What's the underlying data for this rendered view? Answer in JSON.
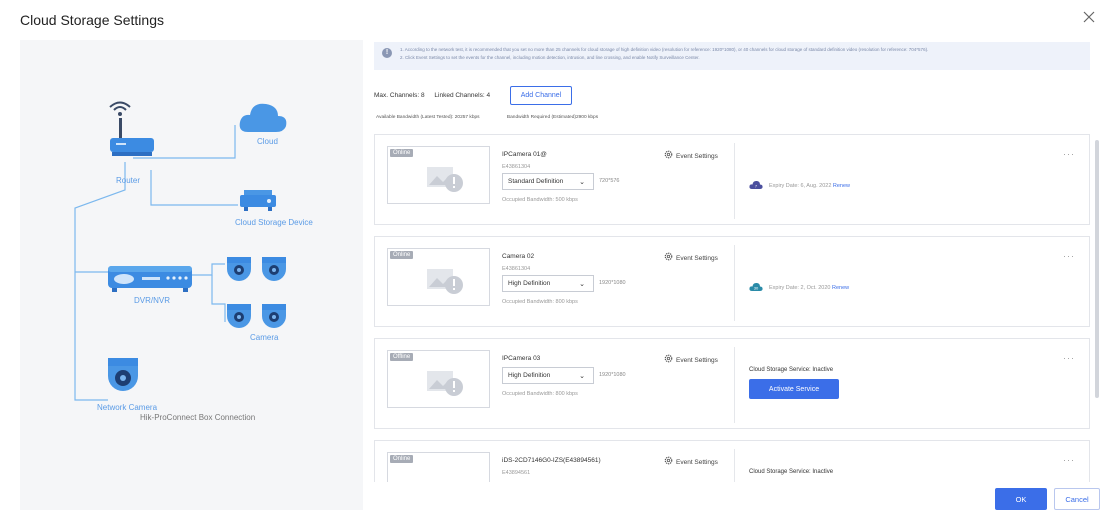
{
  "dialog": {
    "title": "Cloud Storage Settings",
    "close_icon": "close-icon"
  },
  "diagram": {
    "router": "Router",
    "cloud": "Cloud",
    "cloud_storage_device": "Cloud Storage Device",
    "dvr_nvr": "DVR/NVR",
    "camera": "Camera",
    "network_camera": "Network Camera",
    "hik_connection": "Hik-ProConnect Box Connection"
  },
  "notice": {
    "line1": "1. According to the network test, it is recommended that you set no more than 25 channels for cloud storage of high definition video (resolution for reference: 1920*1080), or 40 channels for cloud storage of standard definition video (resolution for reference: 704*576).",
    "line2": "2. Click Event Settings to set the events for the channel, including motion detection, intrusion, and line crossing, and enable Notify Surveillance Center."
  },
  "channels": {
    "max_label": "Max. Channels: 8",
    "linked_label": "Linked Channels: 4",
    "add_button": "Add Channel",
    "available_bw": "Available Bandwidth (Latest Tested): 20257 kbps",
    "required_bw": "Bandwidth Required (Estimated)2900 kbps"
  },
  "cards": [
    {
      "status": "Online",
      "name": "IPCamera 01@",
      "serial": "E43861304",
      "definition": "Standard Definition",
      "resolution": "720*576",
      "occupied": "Occupied Bandwidth: 500 kbps",
      "event_settings": "Event Settings",
      "expiry": "Expiry Date: 6, Aug. 2022",
      "renew": "Renew",
      "cloud_badge": "7"
    },
    {
      "status": "Online",
      "name": "Camera 02",
      "serial": "E43861304",
      "definition": "High Definition",
      "resolution": "1920*1080",
      "occupied": "Occupied Bandwidth: 800 kbps",
      "event_settings": "Event Settings",
      "expiry": "Expiry Date: 2, Oct. 2020",
      "renew": "Renew",
      "cloud_badge": "30"
    },
    {
      "status": "Offline",
      "name": "IPCamera 03",
      "definition": "High Definition",
      "resolution": "1920*1080",
      "occupied": "Occupied Bandwidth: 800 kbps",
      "event_settings": "Event Settings",
      "inactive": "Cloud Storage Service: Inactive",
      "activate": "Activate Service"
    },
    {
      "status": "Online",
      "name": "iDS-2CD7146G0-IZS(E43894561)",
      "serial": "E43894561",
      "event_settings": "Event Settings",
      "inactive": "Cloud Storage Service: Inactive"
    }
  ],
  "footer": {
    "ok": "OK",
    "cancel": "Cancel"
  },
  "colors": {
    "accent": "#3b6ee8",
    "diagram_blue": "#5aa7ec"
  }
}
